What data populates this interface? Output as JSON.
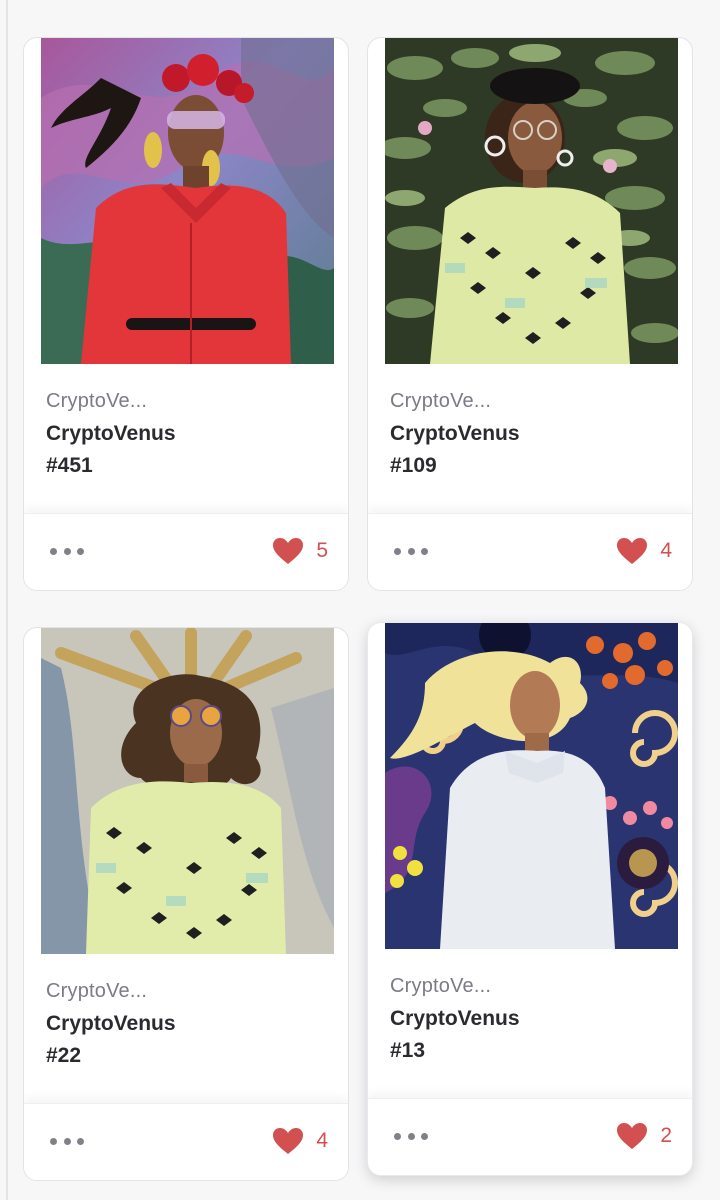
{
  "accent_color": "#d2504f",
  "cards": [
    {
      "collection": "CryptoVe...",
      "name": "CryptoVenus",
      "number": "#451",
      "likes": "5",
      "art": "venus-red-dress-roses"
    },
    {
      "collection": "CryptoVe...",
      "name": "CryptoVenus",
      "number": "#109",
      "likes": "4",
      "art": "venus-beret-water-lilies"
    },
    {
      "collection": "CryptoVe...",
      "name": "CryptoVenus",
      "number": "#22",
      "likes": "4",
      "art": "venus-sunburst-crown"
    },
    {
      "collection": "CryptoVe...",
      "name": "CryptoVenus",
      "number": "#13",
      "likes": "2",
      "art": "venus-white-sweater-swirls"
    }
  ],
  "icons": {
    "more": "more-horizontal-icon",
    "like": "heart-icon"
  }
}
